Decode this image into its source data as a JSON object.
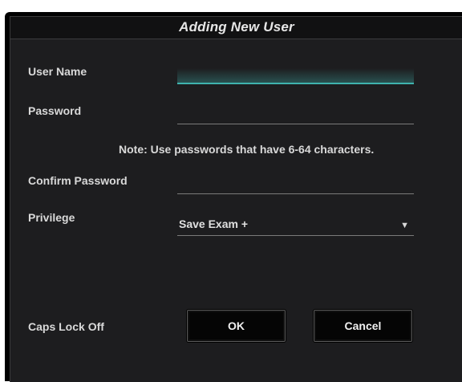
{
  "dialog": {
    "title": "Adding New User"
  },
  "form": {
    "user_name_label": "User Name",
    "user_name_value": "",
    "password_label": "Password",
    "password_value": "",
    "note": "Note: Use passwords that have 6-64 characters.",
    "confirm_password_label": "Confirm Password",
    "confirm_password_value": "",
    "privilege_label": "Privilege",
    "privilege_value": "Save Exam +",
    "privilege_arrow": "▼"
  },
  "footer": {
    "caps_lock_status": "Caps Lock Off",
    "ok_label": "OK",
    "cancel_label": "Cancel"
  },
  "colors": {
    "accent": "#3fb3ad",
    "background": "#1d1d1f",
    "titlebar": "#111112"
  },
  "icons": {
    "dropdown": "chevron-down-icon"
  }
}
